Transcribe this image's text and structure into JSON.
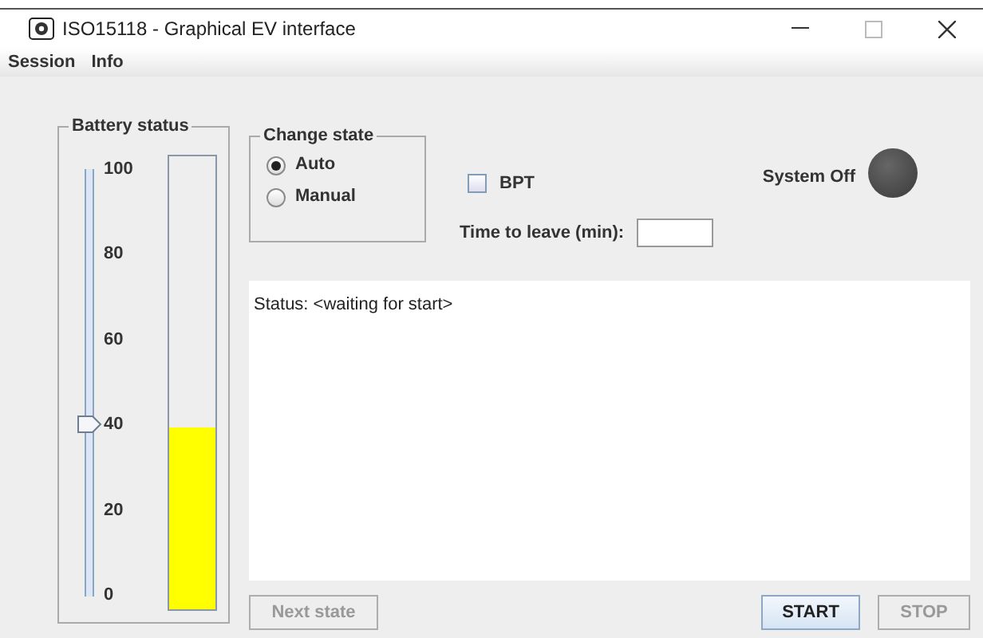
{
  "window": {
    "title": "ISO15118 - Graphical EV interface"
  },
  "menu": [
    "Session",
    "Info"
  ],
  "battery": {
    "title": "Battery status",
    "slider": {
      "level": 0.4
    },
    "ticks": [
      "100",
      "80",
      "60",
      "40",
      "20",
      "0"
    ],
    "bar": {
      "level": 0.4
    }
  },
  "change_state": {
    "title": "Change state",
    "options": [
      {
        "label": "Auto",
        "selected": true
      },
      {
        "label": "Manual",
        "selected": false
      }
    ]
  },
  "bpt": {
    "label": "BPT",
    "checked": false
  },
  "time_to_leave": {
    "label": "Time to leave (min):"
  },
  "system": {
    "label": "System Off",
    "on": false
  },
  "status": "Status: <waiting for start>",
  "buttons": [
    {
      "label": "Next state",
      "disabled": true,
      "primary": false
    },
    {
      "label": "START",
      "disabled": false,
      "primary": true
    },
    {
      "label": "STOP",
      "disabled": true,
      "primary": false
    }
  ]
}
